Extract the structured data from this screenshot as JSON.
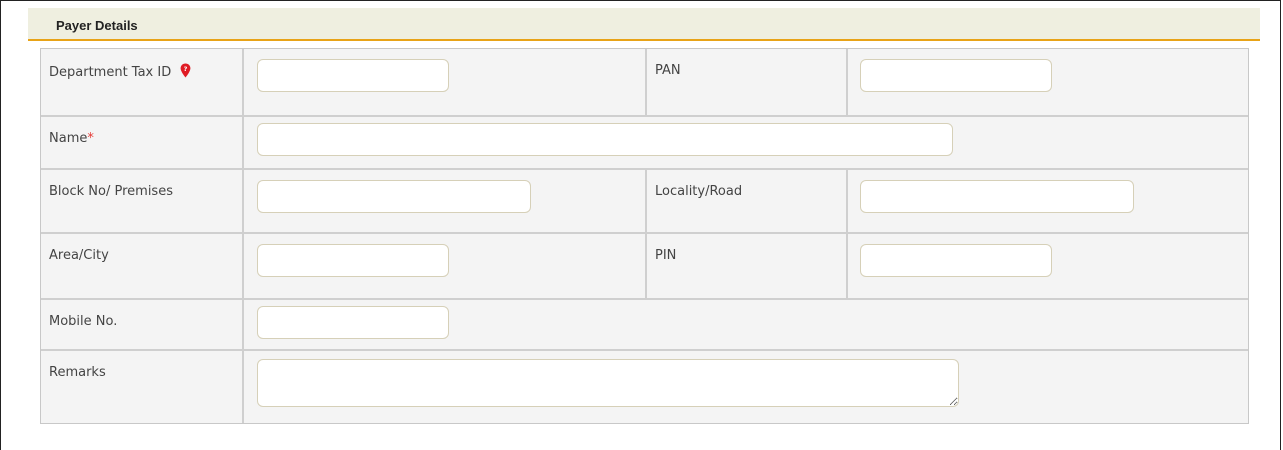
{
  "section": {
    "title": "Payer Details"
  },
  "fields": {
    "department_tax_id": {
      "label": "Department Tax ID",
      "value": "",
      "icon": "location-pin-icon"
    },
    "pan": {
      "label": "PAN",
      "value": ""
    },
    "name": {
      "label": "Name",
      "required_mark": "*",
      "value": ""
    },
    "block_no": {
      "label": "Block No/ Premises",
      "value": ""
    },
    "locality": {
      "label": "Locality/Road",
      "value": ""
    },
    "area_city": {
      "label": "Area/City",
      "value": ""
    },
    "pin": {
      "label": "PIN",
      "value": ""
    },
    "mobile": {
      "label": "Mobile No.",
      "value": ""
    },
    "remarks": {
      "label": "Remarks",
      "value": ""
    }
  },
  "colors": {
    "accent": "#e8a317",
    "required": "#e53935",
    "header_bg": "#efefe0",
    "row_bg": "#f4f4f4"
  }
}
